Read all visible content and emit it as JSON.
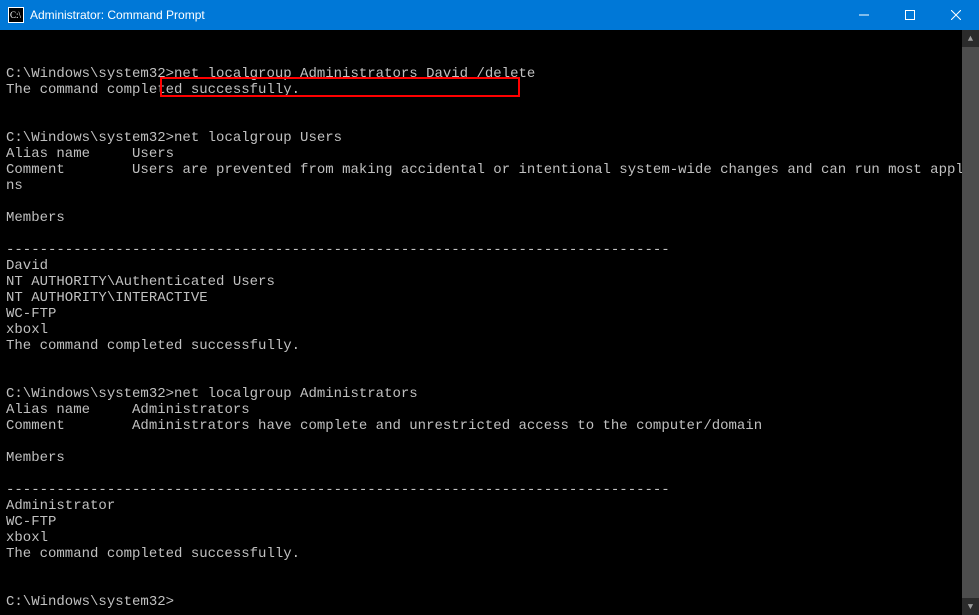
{
  "window": {
    "title": "Administrator: Command Prompt"
  },
  "prompt": "C:\\Windows\\system32>",
  "highlighted_command": "net localgroup Administrators David /delete",
  "lines": {
    "cmd1": "net localgroup Administrators David /delete",
    "success1": "The command completed successfully.",
    "blank": "",
    "cmd2": "net localgroup Users",
    "alias2_label": "Alias name     ",
    "alias2_value": "Users",
    "comment2_label": "Comment        ",
    "comment2_value": "Users are prevented from making accidental or intentional system-wide changes and can run most applicatio",
    "comment2_wrap": "ns",
    "members_label": "Members",
    "divider": "-------------------------------------------------------------------------------",
    "m1": "David",
    "m2": "NT AUTHORITY\\Authenticated Users",
    "m3": "NT AUTHORITY\\INTERACTIVE",
    "m4": "WC-FTP",
    "m5": "xboxl",
    "success2": "The command completed successfully.",
    "cmd3": "net localgroup Administrators",
    "alias3_label": "Alias name     ",
    "alias3_value": "Administrators",
    "comment3_label": "Comment        ",
    "comment3_value": "Administrators have complete and unrestricted access to the computer/domain",
    "a1": "Administrator",
    "a2": "WC-FTP",
    "a3": "xboxl",
    "success3": "The command completed successfully."
  }
}
